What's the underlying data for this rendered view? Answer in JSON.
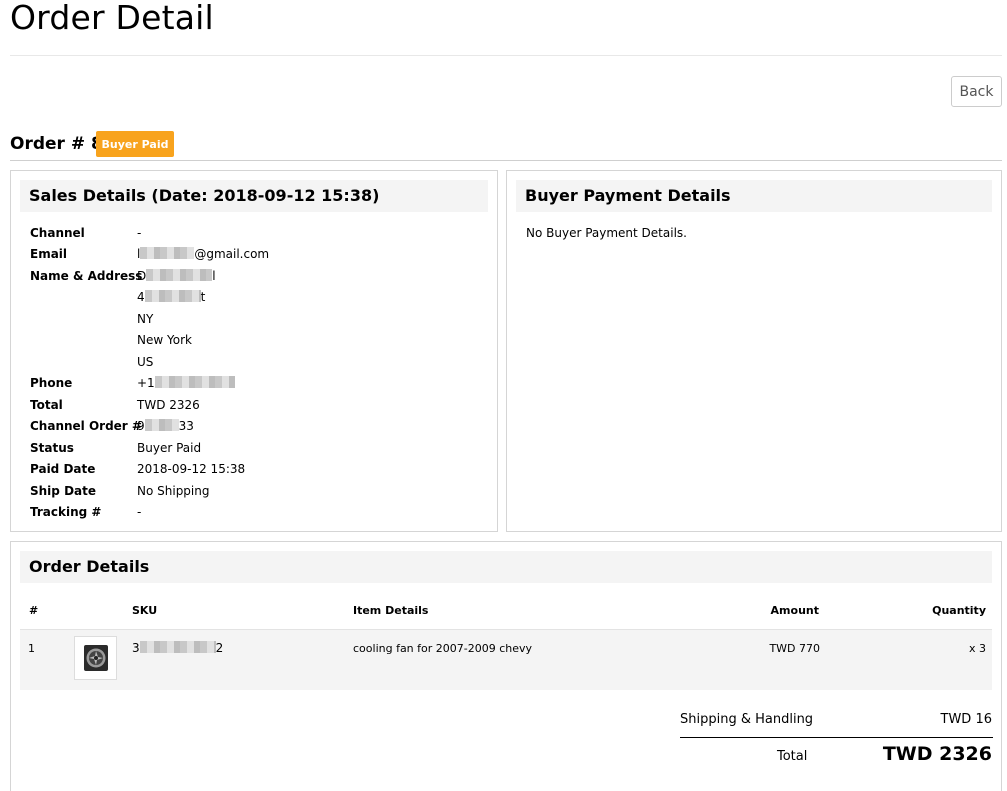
{
  "page": {
    "title": "Order Detail",
    "back_label": "Back",
    "order_heading": "Order # 8",
    "status_badge": "Buyer Paid",
    "status_badge_color": "#f8a31d"
  },
  "sales": {
    "header": "Sales Details (Date: 2018-09-12 15:38)",
    "channel_label": "Channel",
    "channel_value": "-",
    "email_label": "Email",
    "email_prefix": "l",
    "email_suffix": "@gmail.com",
    "name_address_label": "Name & Address",
    "name_prefix": "D",
    "name_suffix": "l",
    "street_prefix": "4",
    "street_suffix": "t",
    "state": "NY",
    "city": "New York",
    "country": "US",
    "phone_label": "Phone",
    "phone_prefix": "+1",
    "total_label": "Total",
    "total_value": "TWD 2326",
    "channel_order_label": "Channel Order #",
    "channel_order_prefix": "9",
    "channel_order_suffix": "33",
    "status_label": "Status",
    "status_value": "Buyer Paid",
    "paid_date_label": "Paid Date",
    "paid_date_value": "2018-09-12 15:38",
    "ship_date_label": "Ship Date",
    "ship_date_value": "No Shipping",
    "tracking_label": "Tracking #",
    "tracking_value": "-"
  },
  "buyer_payment": {
    "header": "Buyer Payment Details",
    "empty_text": "No Buyer Payment Details."
  },
  "order_details": {
    "header": "Order Details",
    "columns": {
      "num": "#",
      "sku": "SKU",
      "item_details": "Item Details",
      "amount": "Amount",
      "quantity": "Quantity"
    },
    "items": [
      {
        "num": "1",
        "image_icon": "radiator-fan-thumbnail",
        "sku_prefix": "3",
        "sku_suffix": "2",
        "item_details": "cooling fan for 2007-2009 chevy",
        "amount": "TWD 770",
        "quantity": "x 3"
      }
    ],
    "shipping_label": "Shipping & Handling",
    "shipping_value": "TWD 16",
    "total_label": "Total",
    "total_value": "TWD 2326"
  }
}
